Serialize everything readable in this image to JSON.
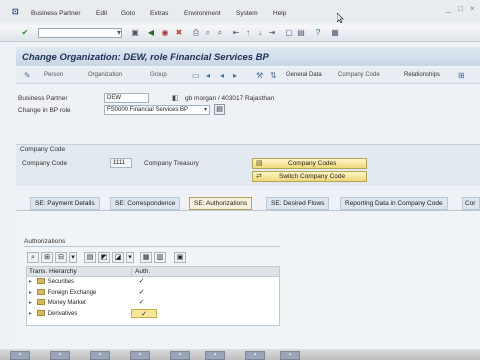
{
  "menubar": {
    "items": [
      "Business Partner",
      "Edit",
      "Goto",
      "Extras",
      "Environment",
      "System",
      "Help"
    ]
  },
  "titlebar": {
    "title": "Change Organization: DEW, role Financial Services BP"
  },
  "app_toolbar": {
    "items": [
      "Person",
      "Organization",
      "Group",
      "General Data",
      "Company Code",
      "Relationships"
    ]
  },
  "header": {
    "business_partner_label": "Business Partner",
    "business_partner_value": "DEW",
    "bp_description": "gb morgan / 403017 Rajasthan",
    "change_role_label": "Change in BP role",
    "change_role_value": "FS0000 Financial Services BP"
  },
  "company_code_section": {
    "title": "Company Code",
    "company_code_label": "Company Code",
    "company_code_value": "1111",
    "company_name": "Company Treasury",
    "btn_company_codes": "Company Codes",
    "btn_switch_company_code": "Switch Company Code"
  },
  "tabs": [
    {
      "label": "SE: Payment Details",
      "active": false
    },
    {
      "label": "SE: Correspondence",
      "active": false
    },
    {
      "label": "SE: Authorizations",
      "active": true
    },
    {
      "label": "SE: Desired Flows",
      "active": false
    },
    {
      "label": "Reporting Data in Company Code",
      "active": false
    },
    {
      "label": "Cor",
      "active": false
    }
  ],
  "authorizations": {
    "title": "Authorizations",
    "columns": [
      "Trans. Hierarchy",
      "Auth."
    ],
    "rows": [
      {
        "label": "Securities",
        "checked": true
      },
      {
        "label": "Foreign Exchange",
        "checked": true
      },
      {
        "label": "Money Market",
        "checked": true
      },
      {
        "label": "Derivatives",
        "checked": true
      }
    ]
  },
  "colors": {
    "title_text": "#1c2f5a",
    "button_yellow": "#f1d77c",
    "active_tab": "#f7f1dc"
  }
}
